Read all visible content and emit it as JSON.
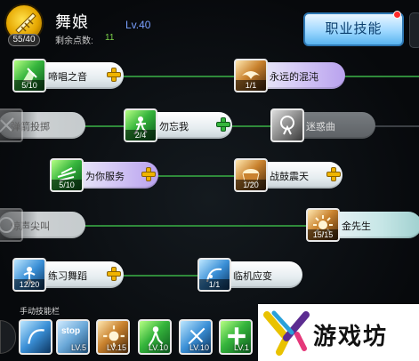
{
  "header": {
    "points_badge": "55/40",
    "class_name": "舞娘",
    "level": "Lv.40",
    "remaining_points_label": "剩余点数:",
    "remaining_points_value": "11",
    "class_skill_button": "职业技能"
  },
  "colors": {
    "accent_blue": "#5ab4f0",
    "connector_green": "#2f8a3a",
    "plus_yellow": "#f0b400",
    "plus_green": "#35b53c",
    "notify_red": "#ff2a2a"
  },
  "skills": [
    {
      "name": "啼唱之音",
      "level": "5/10",
      "icon": "fist-icon",
      "action": "yellow-plus"
    },
    {
      "name": "永远的混沌",
      "level": "1/1",
      "icon": "eagle-icon",
      "action": "none"
    },
    {
      "name": "弹箭投掷",
      "level": "",
      "icon": "crossbow-icon",
      "action": "none"
    },
    {
      "name": "勿忘我",
      "level": "2/4",
      "icon": "dancer-icon",
      "action": "green-plus"
    },
    {
      "name": "迷惑曲",
      "level": "",
      "icon": "figure-icon",
      "action": "none"
    },
    {
      "name": "为你服务",
      "level": "5/10",
      "icon": "dash-icon",
      "action": "yellow-plus"
    },
    {
      "name": "战鼓震天",
      "level": "1/20",
      "icon": "drum-icon",
      "action": "yellow-plus"
    },
    {
      "name": "惊声尖叫",
      "level": "",
      "icon": "scream-icon",
      "action": "none"
    },
    {
      "name": "金先生",
      "level": "15/15",
      "icon": "sun-icon",
      "action": "none"
    },
    {
      "name": "练习舞蹈",
      "level": "12/20",
      "icon": "dance-practice-icon",
      "action": "yellow-plus"
    },
    {
      "name": "临机应变",
      "level": "1/1",
      "icon": "whip-icon",
      "action": "none"
    }
  ],
  "hotbar": {
    "title": "手动技能栏",
    "slots": [
      {
        "icon": "whip-icon",
        "label": "",
        "level": ""
      },
      {
        "icon": "stop-icon",
        "label": "stop",
        "level": "LV.5"
      },
      {
        "icon": "sun-icon",
        "label": "",
        "level": "LV.15"
      },
      {
        "icon": "dancer-icon",
        "label": "",
        "level": "LV.10"
      },
      {
        "icon": "crossbow-icon",
        "label": "",
        "level": "LV.10"
      },
      {
        "icon": "heal-icon",
        "label": "",
        "level": "LV.1"
      }
    ]
  },
  "watermark": {
    "text": "游戏坊"
  }
}
